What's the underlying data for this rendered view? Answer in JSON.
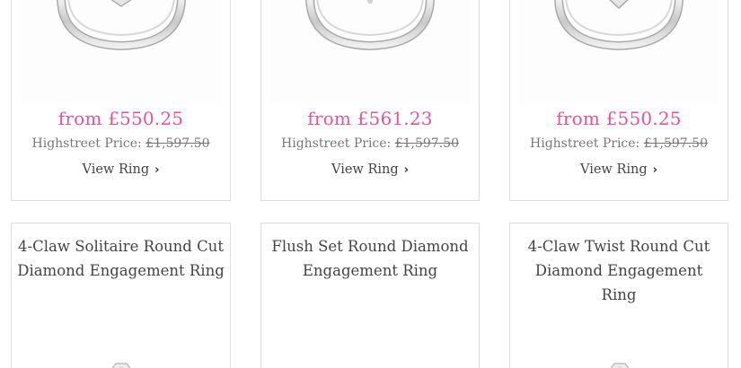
{
  "products": [
    {
      "price": "from £550.25",
      "highstreet_label": "Highstreet Price:",
      "highstreet_value": "£1,597.50",
      "view_label": "View Ring"
    },
    {
      "price": "from £561.23",
      "highstreet_label": "Highstreet Price:",
      "highstreet_value": "£1,597.50",
      "view_label": "View Ring"
    },
    {
      "price": "from £550.25",
      "highstreet_label": "Highstreet Price:",
      "highstreet_value": "£1,597.50",
      "view_label": "View Ring"
    },
    {
      "title_line1": "4-Claw Solitaire Round Cut",
      "title_line2": "Diamond Engagement Ring"
    },
    {
      "title_line1": "Flush Set Round Diamond",
      "title_line2": "Engagement Ring"
    },
    {
      "title_line1": "4-Claw Twist Round Cut",
      "title_line2": "Diamond Engagement Ring"
    }
  ],
  "colors": {
    "price": "#e0569a",
    "border": "#dcdcdc",
    "text": "#444444",
    "muted": "#777777"
  },
  "icons": {
    "view_chevron": "chevron-right-icon",
    "product_image": "ring-image"
  }
}
